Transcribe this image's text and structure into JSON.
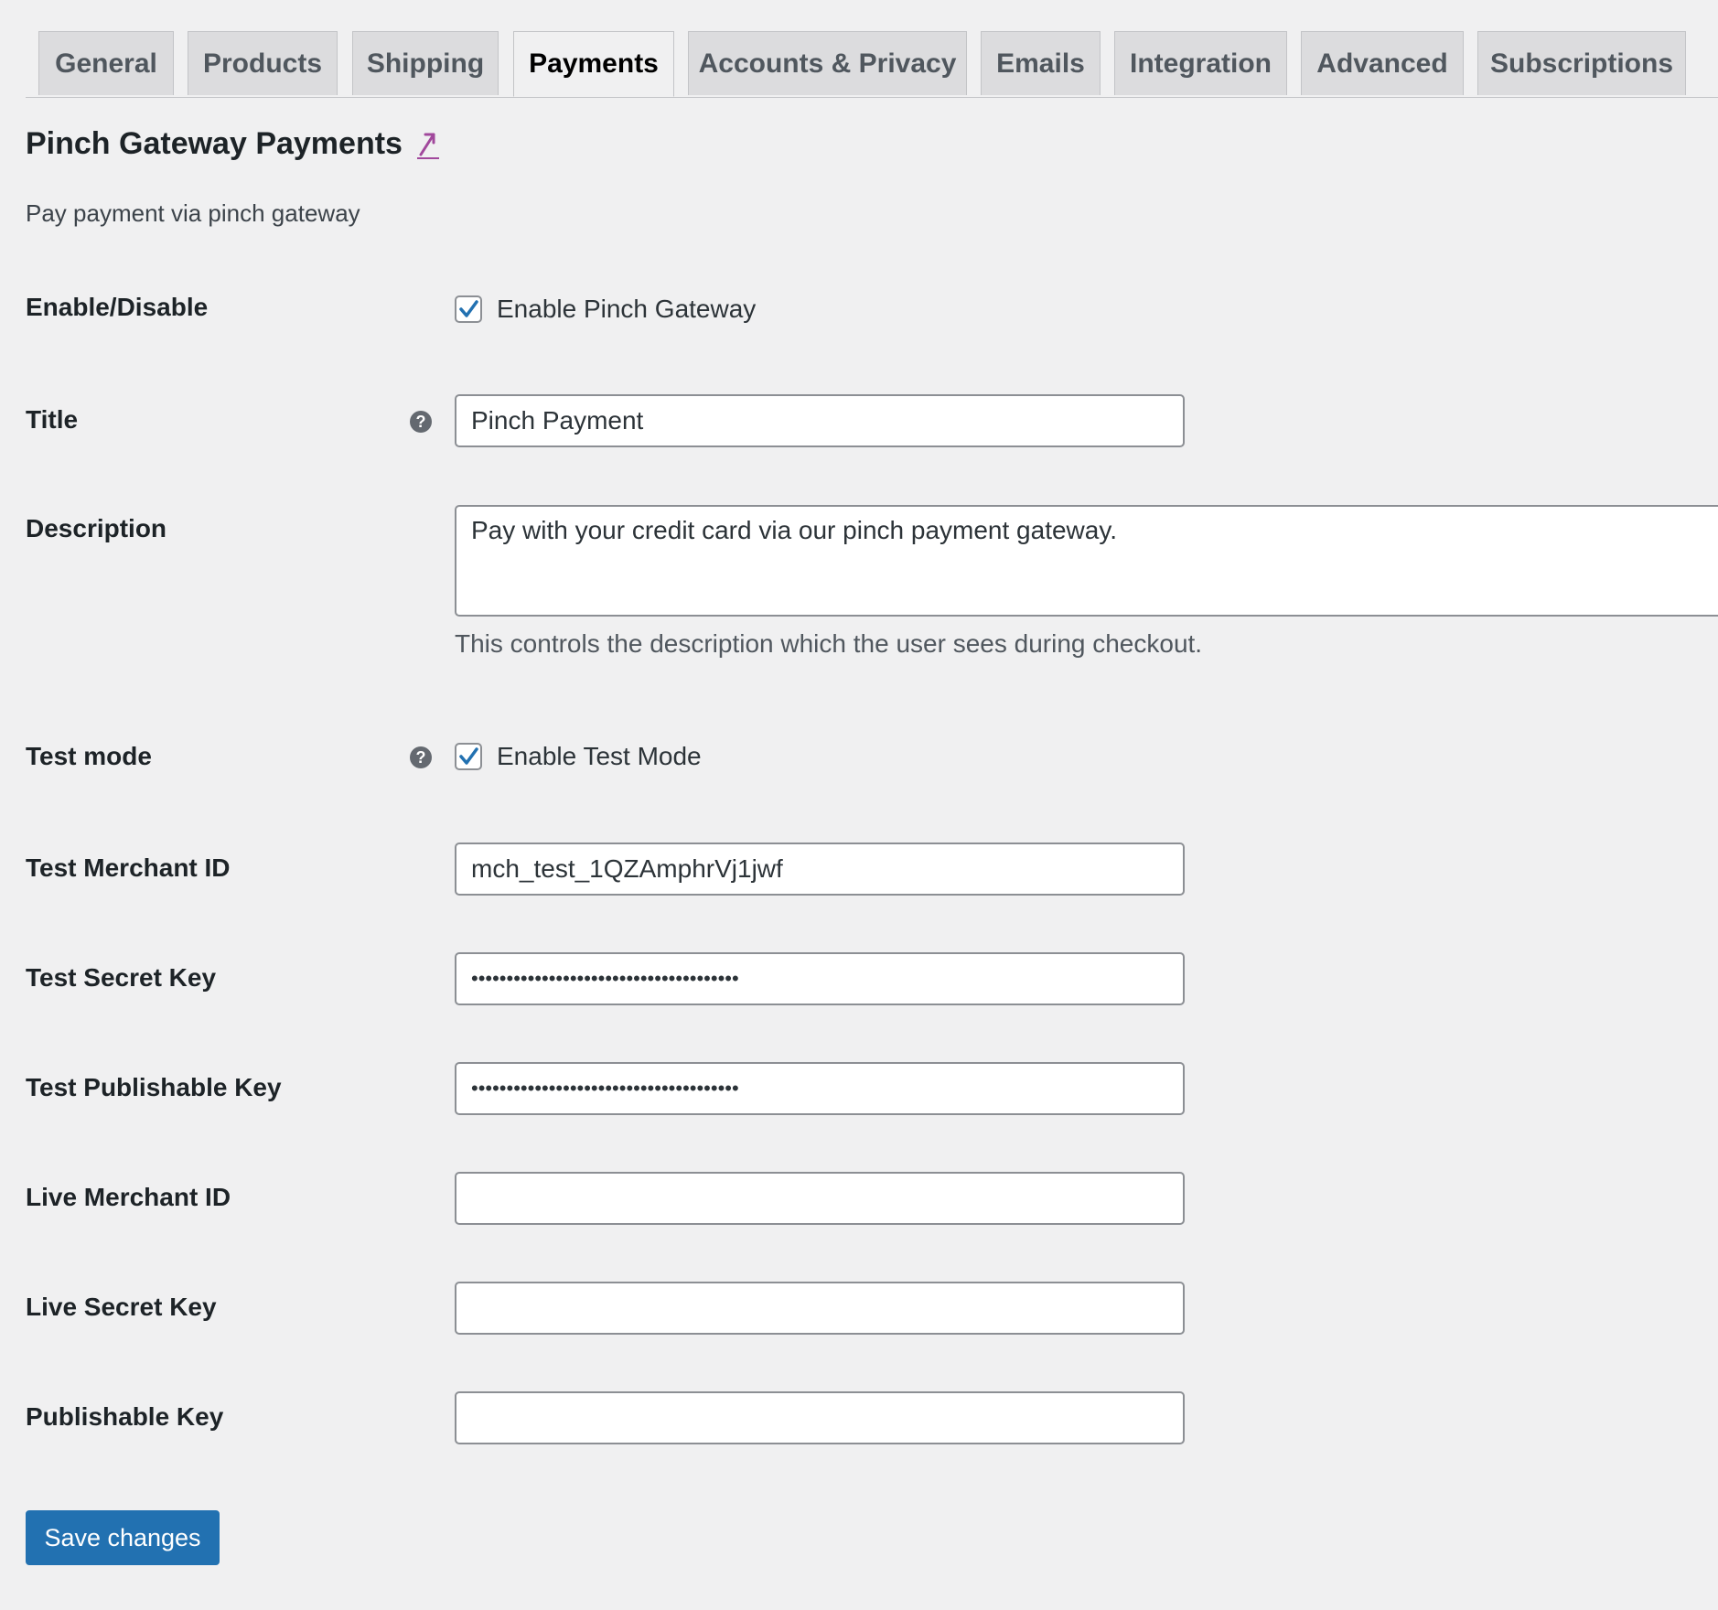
{
  "tabs": [
    {
      "label": "General",
      "active": false
    },
    {
      "label": "Products",
      "active": false
    },
    {
      "label": "Shipping",
      "active": false
    },
    {
      "label": "Payments",
      "active": true
    },
    {
      "label": "Accounts & Privacy",
      "active": false
    },
    {
      "label": "Emails",
      "active": false
    },
    {
      "label": "Integration",
      "active": false
    },
    {
      "label": "Advanced",
      "active": false
    },
    {
      "label": "Subscriptions",
      "active": false
    }
  ],
  "header": {
    "title": "Pinch Gateway Payments",
    "subtitle": "Pay payment via pinch gateway",
    "link_icon": "up-arrow-icon"
  },
  "form": {
    "enable": {
      "label": "Enable/Disable",
      "checkbox_label": "Enable Pinch Gateway",
      "checked": true
    },
    "title": {
      "label": "Title",
      "value": "Pinch Payment",
      "help_icon": "help-icon"
    },
    "description": {
      "label": "Description",
      "value": "Pay with your credit card via our pinch payment gateway.",
      "help_text": "This controls the description which the user sees during checkout."
    },
    "test_mode": {
      "label": "Test mode",
      "checkbox_label": "Enable Test Mode",
      "checked": true,
      "help_icon": "help-icon"
    },
    "test_merchant_id": {
      "label": "Test Merchant ID",
      "value": "mch_test_1QZAmphrVj1jwf"
    },
    "test_secret_key": {
      "label": "Test Secret Key",
      "value": "••••••••••••••••••••••••••••••••••••••"
    },
    "test_publishable_key": {
      "label": "Test Publishable Key",
      "value": "••••••••••••••••••••••••••••••••••••••"
    },
    "live_merchant_id": {
      "label": "Live Merchant ID",
      "value": ""
    },
    "live_secret_key": {
      "label": "Live Secret Key",
      "value": ""
    },
    "publishable_key": {
      "label": "Publishable Key",
      "value": ""
    }
  },
  "actions": {
    "save_label": "Save changes"
  },
  "colors": {
    "accent": "#2271b1",
    "link": "#a1489c",
    "background": "#f0f0f1"
  }
}
